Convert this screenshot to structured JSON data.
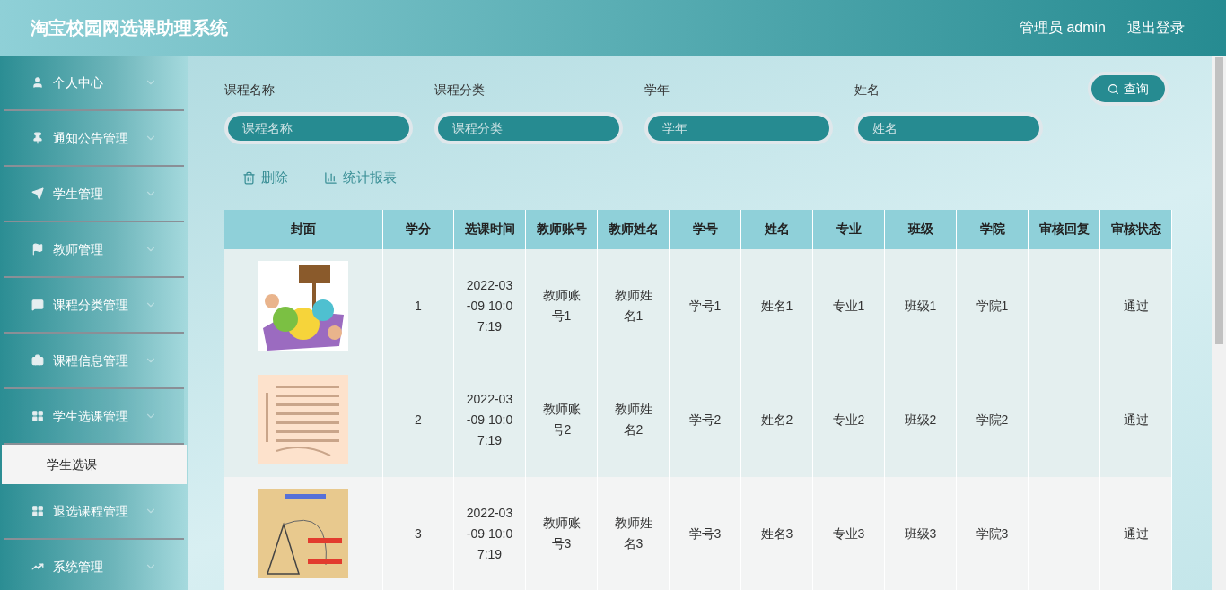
{
  "header": {
    "title": "淘宝校园网选课助理系统",
    "user": "管理员 admin",
    "logout": "退出登录"
  },
  "menu": [
    {
      "label": "个人中心",
      "expanded": false
    },
    {
      "label": "通知公告管理",
      "expanded": false
    },
    {
      "label": "学生管理",
      "expanded": false
    },
    {
      "label": "教师管理",
      "expanded": false
    },
    {
      "label": "课程分类管理",
      "expanded": false
    },
    {
      "label": "课程信息管理",
      "expanded": false
    },
    {
      "label": "学生选课管理",
      "expanded": true,
      "children": [
        {
          "label": "学生选课",
          "selected": true
        }
      ]
    },
    {
      "label": "退选课程管理",
      "expanded": false
    },
    {
      "label": "系统管理",
      "expanded": false
    }
  ],
  "filters": [
    {
      "label": "课程名称",
      "placeholder": "课程名称"
    },
    {
      "label": "课程分类",
      "placeholder": "课程分类"
    },
    {
      "label": "学年",
      "placeholder": "学年"
    },
    {
      "label": "姓名",
      "placeholder": "姓名"
    }
  ],
  "search_button": "查询",
  "actions": [
    {
      "kind": "delete",
      "label": "删除"
    },
    {
      "kind": "report",
      "label": "统计报表"
    }
  ],
  "table": {
    "columns": [
      "封面",
      "学分",
      "选课时间",
      "教师账号",
      "教师姓名",
      "学号",
      "姓名",
      "专业",
      "班级",
      "学院",
      "审核回复",
      "审核状态"
    ],
    "rows": [
      {
        "cells": [
          {
            "kind": "picture"
          },
          {
            "kind": "text",
            "text": "1"
          },
          {
            "kind": "text",
            "text": "2022-03-09 10:07:19"
          },
          {
            "kind": "text",
            "text": "教师账号1"
          },
          {
            "kind": "text",
            "text": "教师姓名1"
          },
          {
            "kind": "text",
            "text": "学号1"
          },
          {
            "kind": "text",
            "text": "姓名1"
          },
          {
            "kind": "text",
            "text": "专业1"
          },
          {
            "kind": "text",
            "text": "班级1"
          },
          {
            "kind": "text",
            "text": "学院1"
          },
          {
            "kind": "empty"
          },
          {
            "kind": "text",
            "text": "通过"
          }
        ]
      },
      {
        "cells": [
          {
            "kind": "picture"
          },
          {
            "kind": "text",
            "text": "2"
          },
          {
            "kind": "text",
            "text": "2022-03-09 10:07:19"
          },
          {
            "kind": "text",
            "text": "教师账号2"
          },
          {
            "kind": "text",
            "text": "教师姓名2"
          },
          {
            "kind": "text",
            "text": "学号2"
          },
          {
            "kind": "text",
            "text": "姓名2"
          },
          {
            "kind": "text",
            "text": "专业2"
          },
          {
            "kind": "text",
            "text": "班级2"
          },
          {
            "kind": "text",
            "text": "学院2"
          },
          {
            "kind": "empty"
          },
          {
            "kind": "text",
            "text": "通过"
          }
        ]
      },
      {
        "cells": [
          {
            "kind": "picture"
          },
          {
            "kind": "text",
            "text": "3"
          },
          {
            "kind": "text",
            "text": "2022-03-09 10:07:19"
          },
          {
            "kind": "text",
            "text": "教师账号3"
          },
          {
            "kind": "text",
            "text": "教师姓名3"
          },
          {
            "kind": "text",
            "text": "学号3"
          },
          {
            "kind": "text",
            "text": "姓名3"
          },
          {
            "kind": "text",
            "text": "专业3"
          },
          {
            "kind": "text",
            "text": "班级3"
          },
          {
            "kind": "text",
            "text": "学院3"
          },
          {
            "kind": "empty"
          },
          {
            "kind": "text",
            "text": "通过"
          }
        ]
      }
    ]
  }
}
